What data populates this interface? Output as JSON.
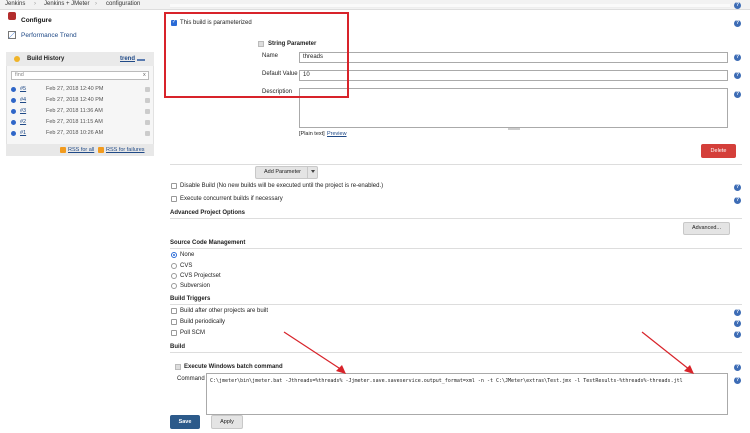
{
  "breadcrumb": [
    "Jenkins",
    "Jenkins + JMeter",
    "configuration"
  ],
  "sidebar": {
    "configure": "Configure",
    "performance_trend": "Performance Trend",
    "build_history": {
      "title": "Build History",
      "trend_link": "trend",
      "find_placeholder": "find",
      "clear": "x",
      "builds": [
        {
          "num": "#5",
          "date": "Feb 27, 2018 12:40 PM"
        },
        {
          "num": "#4",
          "date": "Feb 27, 2018 12:40 PM"
        },
        {
          "num": "#3",
          "date": "Feb 27, 2018 11:36 AM"
        },
        {
          "num": "#2",
          "date": "Feb 27, 2018 11:15 AM"
        },
        {
          "num": "#1",
          "date": "Feb 27, 2018 10:26 AM"
        }
      ],
      "rss_all": "RSS for all",
      "rss_failures": "RSS for failures"
    }
  },
  "params": {
    "checkbox_label": "This build is parameterized",
    "string_param_title": "String Parameter",
    "name_label": "Name",
    "name_value": "threads",
    "default_label": "Default Value",
    "default_value": "10",
    "description_label": "Description",
    "plain_text": "[Plain text]",
    "preview": "Preview",
    "delete": "Delete",
    "add_parameter": "Add Parameter"
  },
  "options": {
    "disable_build": "Disable Build (No new builds will be executed until the project is re-enabled.)",
    "concurrent": "Execute concurrent builds if necessary",
    "advanced_title": "Advanced Project Options",
    "advanced_button": "Advanced..."
  },
  "scm": {
    "title": "Source Code Management",
    "items": [
      "None",
      "CVS",
      "CVS Projectset",
      "Subversion"
    ]
  },
  "triggers": {
    "title": "Build Triggers",
    "items": [
      "Build after other projects are built",
      "Build periodically",
      "Poll SCM"
    ]
  },
  "build": {
    "title": "Build",
    "step_title": "Execute Windows batch command",
    "command_label": "Command",
    "command_value": "C:\\jmeter\\bin\\jmeter.bat -Jthreads=%threads% -Jjmeter.save.saveservice.output_format=xml -n -t C:\\JMeter\\extras\\Test.jmx -l TestResults-%threads%-threads.jtl"
  },
  "buttons": {
    "save": "Save",
    "apply": "Apply"
  },
  "help_glyph": "?"
}
